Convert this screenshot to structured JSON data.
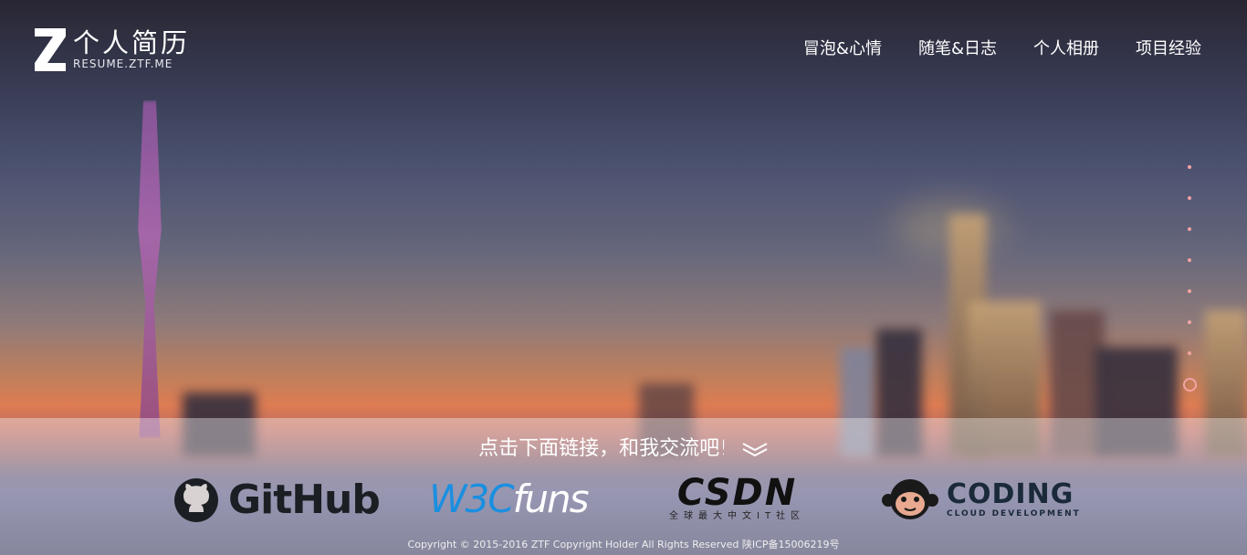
{
  "logo": {
    "mark": "Z",
    "title": "个人简历",
    "subtitle": "RESUME.ZTF.ME"
  },
  "nav": {
    "items": [
      {
        "label": "冒泡&心情"
      },
      {
        "label": "随笔&日志"
      },
      {
        "label": "个人相册"
      },
      {
        "label": "项目经验"
      }
    ]
  },
  "side_nav": {
    "dot_count": 8,
    "active_index": 7,
    "color": "#f4a3a3"
  },
  "footer": {
    "tagline": "点击下面链接，和我交流吧!",
    "partners": {
      "github": {
        "name": "GitHub",
        "icon": "github-octocat-icon"
      },
      "w3cfuns": {
        "prefix": "W3C",
        "suffix": "funs"
      },
      "csdn": {
        "name": "CSDN",
        "sub": "全球最大中文IT社区"
      },
      "coding": {
        "name": "CODING",
        "sub": "CLOUD DEVELOPMENT",
        "icon": "monkey-icon"
      }
    },
    "copyright": "Copyright © 2015-2016 ZTF Copyright Holder All Rights Reserved  陕ICP备15006219号"
  },
  "colors": {
    "accent": "#f4a3a3",
    "github": "#1b1f23",
    "w3c_blue": "#1a8fe0",
    "csdn_red": "#c81624"
  }
}
